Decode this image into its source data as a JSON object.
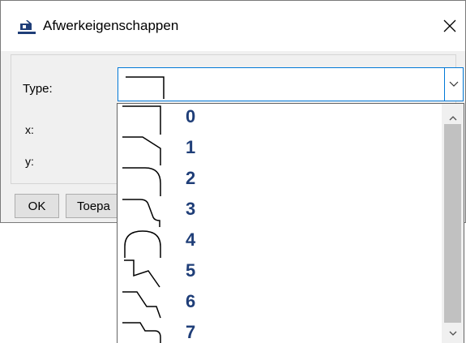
{
  "window": {
    "title": "Afwerkeigenschappen"
  },
  "form": {
    "type_label": "Type:",
    "x_label": "x:",
    "y_label": "y:"
  },
  "buttons": {
    "ok": "OK",
    "apply": "Toepa"
  },
  "dropdown": {
    "options": [
      "0",
      "1",
      "2",
      "3",
      "4",
      "5",
      "6",
      "7"
    ]
  },
  "icons": {
    "app": "app-icon",
    "close": "close-icon",
    "chevron": "chevron-down-icon"
  },
  "colors": {
    "accent": "#0078d7",
    "option_number": "#1f3e78"
  }
}
